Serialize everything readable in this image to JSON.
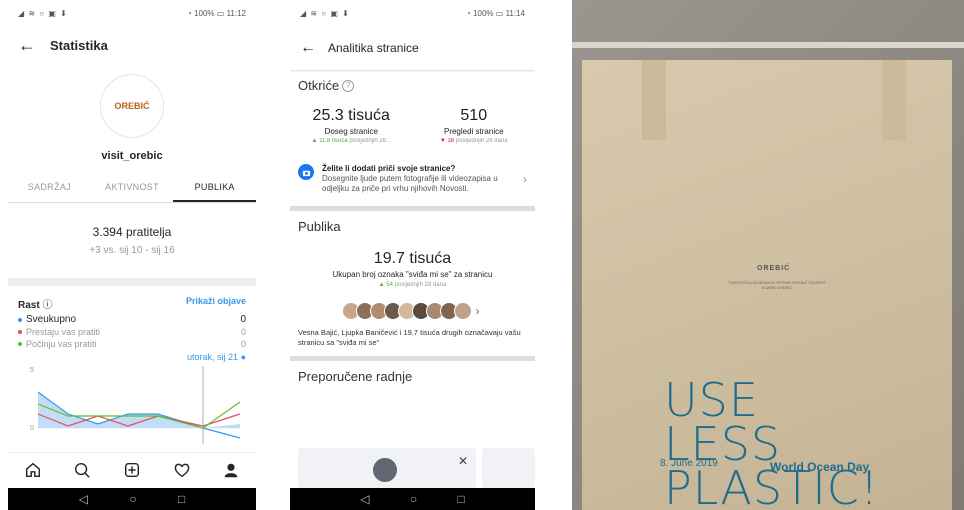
{
  "phone1": {
    "status_time": "11:12",
    "status_battery": "100%",
    "title": "Statistika",
    "logo_text": "OREBIĆ",
    "username": "visit_orebic",
    "tabs": [
      {
        "label": "SADRŽAJ"
      },
      {
        "label": "AKTIVNOST"
      },
      {
        "label": "PUBLIKA"
      }
    ],
    "followers": "3.394 pratitelja",
    "followers_sub": "+3 vs. sij 10 - sij 16",
    "rast": {
      "title": "Rast",
      "link": "Prikaži objave",
      "rows": [
        {
          "label": "Sveukupno",
          "value": "0",
          "color": "#3897f0"
        },
        {
          "label": "Prestaju vas pratiti",
          "value": "0",
          "color": "#ed4956"
        },
        {
          "label": "Počinju vas pratiti",
          "value": "0",
          "color": "#58c322"
        }
      ],
      "date": "utorak, sij 21",
      "y_tick_top": "5",
      "y_tick_bottom": "0"
    },
    "tabbar_icons": [
      "home-icon",
      "search-icon",
      "add-icon",
      "heart-icon",
      "profile-icon"
    ]
  },
  "phone2": {
    "status_time": "11:14",
    "status_battery": "100%",
    "title": "Analitika stranice",
    "discovery_title": "Otkriće",
    "metrics": [
      {
        "value": "25.3 tisuća",
        "label": "Doseg stranice",
        "change_num": "11.8 tisuća",
        "change_rest": "posljednjih 28...",
        "dir": "up"
      },
      {
        "value": "510",
        "label": "Pregledi stranice",
        "change_num": "38",
        "change_rest": "posljednjih 28 dana",
        "dir": "down"
      }
    ],
    "promo": {
      "title": "Želite li dodati priči svoje stranice?",
      "body": "Dosegnite ljude putem fotografije ili videozapisa u odjeljku za priče pri vrhu njihovih Novosti."
    },
    "audience_title": "Publika",
    "likes_value": "19.7 tisuća",
    "likes_label": "Ukupan broj oznaka \"sviđa mi se\" za stranicu",
    "likes_change_num": "54",
    "likes_change_rest": "posljednjih 28 dana",
    "likes_desc": "Vesna Bajić, Ljupka Baničević i 19.7 tisuća drugih označavaju vašu stranicu sa \"sviđa mi se\"",
    "recommended_title": "Preporučene radnje"
  },
  "photo": {
    "logo_text": "OREBIĆ",
    "logo_sub": "TURISTIČKA ZAJEDNICA OPĆINE OREBIĆ TOURIST BOARD OREBIĆ",
    "line1": "USE",
    "line2": "LESS",
    "line3": "PLASTIC!",
    "date": "8. June 2019",
    "event": "World Ocean Day"
  }
}
